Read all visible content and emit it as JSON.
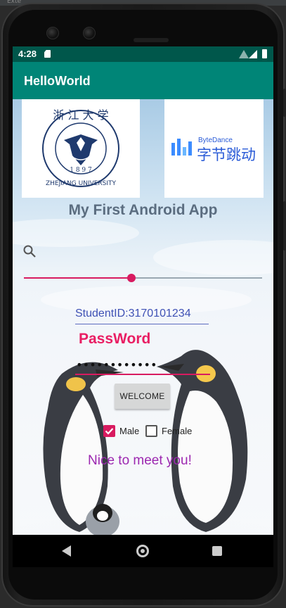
{
  "status_bar": {
    "time": "4:28"
  },
  "app_bar": {
    "title": "HelloWorld"
  },
  "logos": {
    "left_name": "ZJU logo",
    "right_brand_en": "ByteDance",
    "right_brand_cn": "字节跳动"
  },
  "main": {
    "heading": "My First Android App",
    "seekbar_progress": 0.45,
    "student_id": "StudentID:3170101234",
    "password_label": "PassWord",
    "password_value": "••••••••••••",
    "welcome_button": "WELCOME",
    "male_label": "Male",
    "female_label": "Female",
    "male_checked": true,
    "female_checked": false,
    "greeting": "Nice to meet you!"
  },
  "colors": {
    "status_bar": "#00574b",
    "app_bar": "#008577",
    "accent": "#d81b60",
    "student_text": "#3f51b5",
    "password_label": "#e91e63",
    "greeting": "#9c27b0"
  },
  "icons": [
    "sd-card-icon",
    "wifi-icon",
    "signal-icon",
    "battery-icon",
    "search-icon",
    "back-icon",
    "home-icon",
    "recents-icon"
  ]
}
